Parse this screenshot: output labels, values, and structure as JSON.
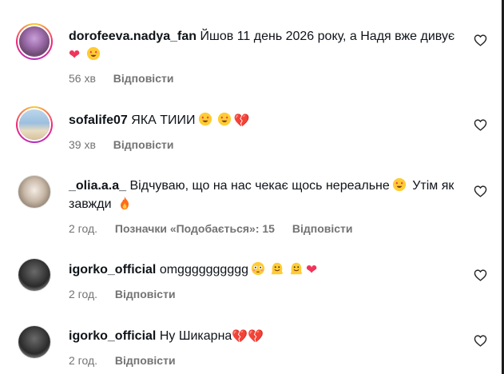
{
  "comments": [
    {
      "username": "dorofeeva.nadya_fan",
      "text": "Йшов 11 день 2026 року, а Надя вже дивує",
      "emojis": [
        "heart",
        "heart-eyes"
      ],
      "time": "56 хв",
      "reply": "Відповісти",
      "avatar_ring": true
    },
    {
      "username": "sofalife07",
      "text": "ЯКА ТИИИ",
      "emojis": [
        "heart-eyes",
        "heart-eyes",
        "broken-heart"
      ],
      "time": "39 хв",
      "reply": "Відповісти",
      "avatar_ring": true
    },
    {
      "username": "_olia.a.a_",
      "text": "Відчуваю, що на нас чекає щось нереальне",
      "text_after": "Утім як завжди",
      "emojis": [
        "heart-eyes",
        "fire"
      ],
      "time": "2 год.",
      "likes": "Позначки «Подобається»: 15",
      "reply": "Відповісти",
      "avatar_ring": false
    },
    {
      "username": "igorko_official",
      "text": "omgggggggggg",
      "emojis": [
        "flushed",
        "melting",
        "melting",
        "heart"
      ],
      "time": "2 год.",
      "reply": "Відповісти",
      "avatar_ring": false
    },
    {
      "username": "igorko_official",
      "text": "Ну Шикарна",
      "emojis": [
        "broken-heart",
        "broken-heart"
      ],
      "time": "2 год.",
      "reply": "Відповісти",
      "avatar_ring": false
    }
  ],
  "icons": {
    "like": "heart-outline-icon"
  }
}
